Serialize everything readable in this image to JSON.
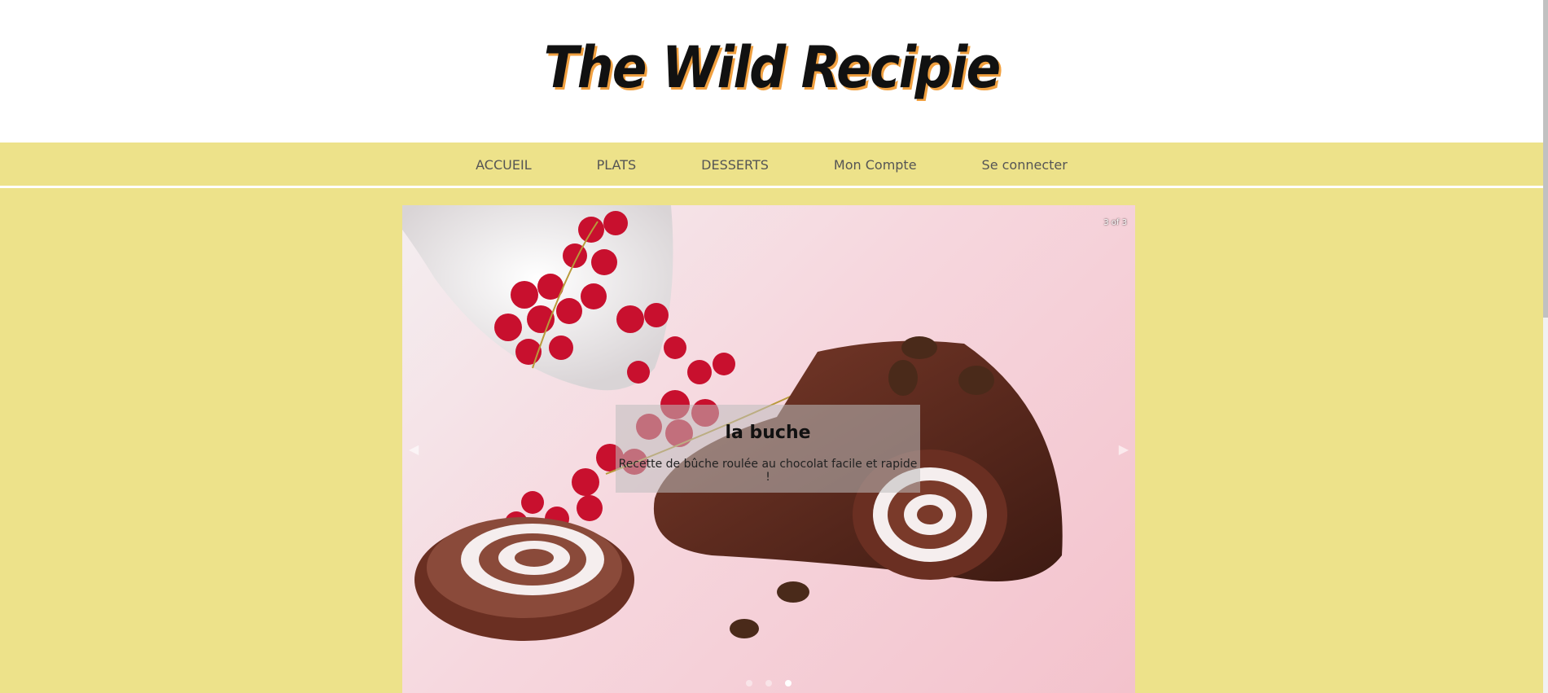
{
  "header": {
    "title": "The Wild Recipie"
  },
  "nav": {
    "items": [
      {
        "label": "ACCUEIL"
      },
      {
        "label": "PLATS"
      },
      {
        "label": "DESSERTS"
      },
      {
        "label": "Mon Compte"
      },
      {
        "label": "Se connecter"
      }
    ]
  },
  "carousel": {
    "counter": "3 of 3",
    "current_slide": 3,
    "total_slides": 3,
    "caption": {
      "title": "la buche",
      "text": "Recette de bûche roulée au chocolat facile et rapide !"
    }
  },
  "colors": {
    "background": "#ede28a",
    "header_background": "#ffffff",
    "title_shadow": "#f0a040",
    "nav_text": "#555555"
  }
}
